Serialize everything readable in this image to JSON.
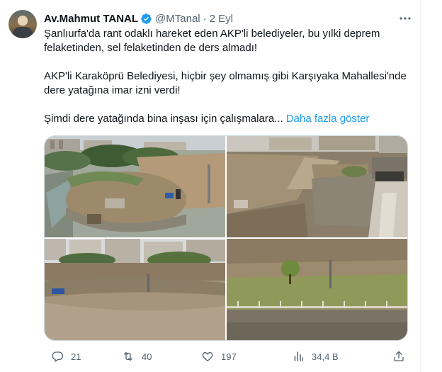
{
  "tweet": {
    "author_name": "Av.Mahmut TANAL",
    "handle": "@MTanal",
    "separator": "·",
    "date": "2 Eyl",
    "paragraph1": "Şanlıurfa'da rant odaklı hareket eden AKP'li belediyeler, bu yılki deprem felaketinden, sel felaketinden de ders almadı!",
    "paragraph2": "AKP'li Karaköprü Belediyesi, hiçbir şey olmamış gibi Karşıyaka Mahallesi'nde dere yatağına imar izni verdi!",
    "paragraph3": "Şimdi dere yatağında bina inşası için çalışmalara...",
    "show_more": "Daha fazla göster"
  },
  "actions": {
    "reply_count": "21",
    "retweet_count": "40",
    "like_count": "197",
    "views_count": "34,4 B"
  },
  "icons": {
    "verified": "verified-badge-icon",
    "more": "more-icon",
    "reply": "reply-icon",
    "retweet": "retweet-icon",
    "like": "heart-icon",
    "views": "views-icon",
    "share": "share-icon"
  },
  "colors": {
    "accent": "#1d9bf0",
    "secondary_text": "#536471",
    "primary_text": "#0f1419"
  }
}
